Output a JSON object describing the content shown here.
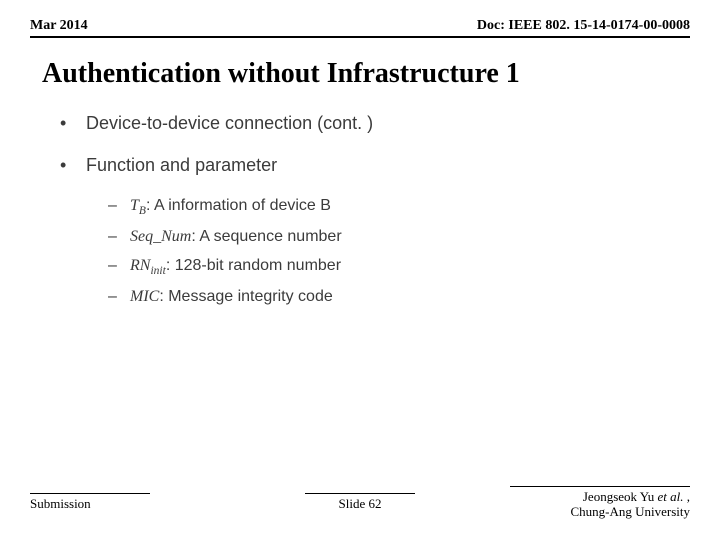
{
  "header": {
    "date": "Mar 2014",
    "doc": "Doc: IEEE 802. 15-14-0174-00-0008"
  },
  "title": "Authentication without Infrastructure 1",
  "content": {
    "b1a": "Device-to-device connection (cont. )",
    "b1b": "Function and parameter",
    "sub": {
      "tb_sym": "T",
      "tb_sub": "B",
      "tb_txt": ": A information of device B",
      "seq_sym": "Seq_Num",
      "seq_txt": ": A sequence number",
      "rn_sym": "RN",
      "rn_sub": "init",
      "rn_txt": ": 128-bit random number",
      "mic_sym": "MIC",
      "mic_txt": ": Message integrity code"
    }
  },
  "footer": {
    "left": "Submission",
    "center": "Slide 62",
    "author": "Jeongseok Yu ",
    "etal": "et al.",
    "comma": " ,",
    "affil": "Chung-Ang University"
  }
}
